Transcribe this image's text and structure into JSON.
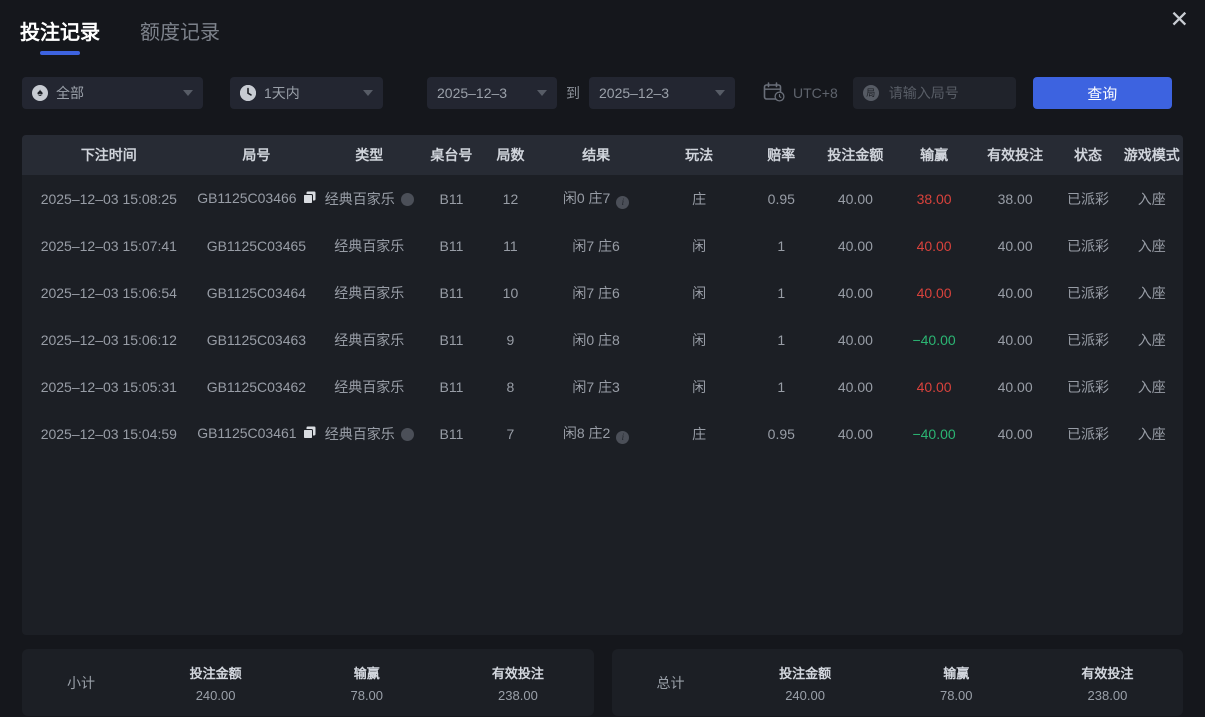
{
  "window": {
    "close_glyph": "✕"
  },
  "colors": {
    "accent_blue": "#3d63e0",
    "win_red": "#d8423c",
    "loss_green": "#2bb573"
  },
  "icons": {
    "game_type_filter": "spade-icon",
    "time_filter": "clock-icon",
    "timezone": "calendar-clock-icon",
    "round_input": "round-badge-icon",
    "copy": "copy-icon",
    "type_info": "circle-icon",
    "result_info": "info-icon",
    "dropdown": "chevron-down-icon",
    "close": "close-icon"
  },
  "tabs": [
    {
      "label": "投注记录",
      "active": true
    },
    {
      "label": "额度记录",
      "active": false
    }
  ],
  "filters": {
    "game_type": {
      "value": "全部"
    },
    "time_range": {
      "value": "1天内"
    },
    "date_from": "2025–12–3",
    "to_label": "到",
    "date_to": "2025–12–3",
    "timezone": "UTC+8",
    "round_input": {
      "placeholder": "请输入局号",
      "value": ""
    },
    "search_button": "查询"
  },
  "table": {
    "headers": [
      "下注时间",
      "局号",
      "类型",
      "桌台号",
      "局数",
      "结果",
      "玩法",
      "赔率",
      "投注金额",
      "输赢",
      "有效投注",
      "状态",
      "游戏模式"
    ],
    "rows": [
      {
        "time": "2025–12–03 15:08:25",
        "round_id": "GB1125C03466",
        "has_copy": true,
        "type": "经典百家乐",
        "has_type_icon": true,
        "table_no": "B11",
        "round_no": "12",
        "result": "闲0 庄7",
        "has_result_icon": true,
        "play": "庄",
        "odds": "0.95",
        "bet": "40.00",
        "winloss": "38.00",
        "winloss_positive": true,
        "valid": "38.00",
        "status": "已派彩",
        "mode": "入座"
      },
      {
        "time": "2025–12–03 15:07:41",
        "round_id": "GB1125C03465",
        "has_copy": false,
        "type": "经典百家乐",
        "has_type_icon": false,
        "table_no": "B11",
        "round_no": "11",
        "result": "闲7 庄6",
        "has_result_icon": false,
        "play": "闲",
        "odds": "1",
        "bet": "40.00",
        "winloss": "40.00",
        "winloss_positive": true,
        "valid": "40.00",
        "status": "已派彩",
        "mode": "入座"
      },
      {
        "time": "2025–12–03 15:06:54",
        "round_id": "GB1125C03464",
        "has_copy": false,
        "type": "经典百家乐",
        "has_type_icon": false,
        "table_no": "B11",
        "round_no": "10",
        "result": "闲7 庄6",
        "has_result_icon": false,
        "play": "闲",
        "odds": "1",
        "bet": "40.00",
        "winloss": "40.00",
        "winloss_positive": true,
        "valid": "40.00",
        "status": "已派彩",
        "mode": "入座"
      },
      {
        "time": "2025–12–03 15:06:12",
        "round_id": "GB1125C03463",
        "has_copy": false,
        "type": "经典百家乐",
        "has_type_icon": false,
        "table_no": "B11",
        "round_no": "9",
        "result": "闲0 庄8",
        "has_result_icon": false,
        "play": "闲",
        "odds": "1",
        "bet": "40.00",
        "winloss": "−40.00",
        "winloss_positive": false,
        "valid": "40.00",
        "status": "已派彩",
        "mode": "入座"
      },
      {
        "time": "2025–12–03 15:05:31",
        "round_id": "GB1125C03462",
        "has_copy": false,
        "type": "经典百家乐",
        "has_type_icon": false,
        "table_no": "B11",
        "round_no": "8",
        "result": "闲7 庄3",
        "has_result_icon": false,
        "play": "闲",
        "odds": "1",
        "bet": "40.00",
        "winloss": "40.00",
        "winloss_positive": true,
        "valid": "40.00",
        "status": "已派彩",
        "mode": "入座"
      },
      {
        "time": "2025–12–03 15:04:59",
        "round_id": "GB1125C03461",
        "has_copy": true,
        "type": "经典百家乐",
        "has_type_icon": true,
        "table_no": "B11",
        "round_no": "7",
        "result": "闲8 庄2",
        "has_result_icon": true,
        "play": "庄",
        "odds": "0.95",
        "bet": "40.00",
        "winloss": "−40.00",
        "winloss_positive": false,
        "valid": "40.00",
        "status": "已派彩",
        "mode": "入座"
      }
    ]
  },
  "summary": {
    "stat_labels": {
      "bet": "投注金额",
      "winloss": "输赢",
      "valid": "有效投注"
    },
    "subtotal": {
      "label": "小计",
      "bet": "240.00",
      "winloss": "78.00",
      "valid": "238.00"
    },
    "total": {
      "label": "总计",
      "bet": "240.00",
      "winloss": "78.00",
      "valid": "238.00"
    }
  }
}
